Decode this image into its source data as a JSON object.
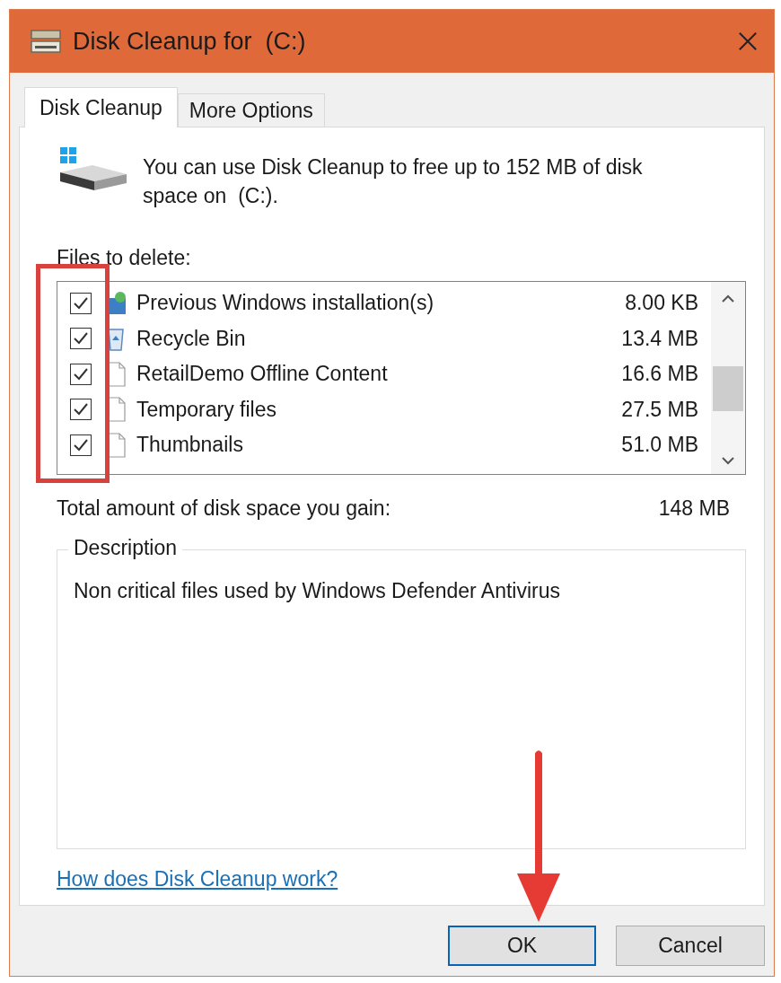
{
  "window": {
    "title": "Disk Cleanup for  (C:)"
  },
  "tabs": [
    {
      "label": "Disk Cleanup",
      "selected": true
    },
    {
      "label": "More Options",
      "selected": false
    }
  ],
  "intro": "You can use Disk Cleanup to free up to 152 MB of disk space on  (C:).",
  "files_label": "Files to delete:",
  "files": [
    {
      "name": "Previous Windows installation(s)",
      "size": "8.00 KB",
      "checked": true,
      "kind": "setup"
    },
    {
      "name": "Recycle Bin",
      "size": "13.4 MB",
      "checked": true,
      "kind": "recycle"
    },
    {
      "name": "RetailDemo Offline Content",
      "size": "16.6 MB",
      "checked": true,
      "kind": "file"
    },
    {
      "name": "Temporary files",
      "size": "27.5 MB",
      "checked": true,
      "kind": "file"
    },
    {
      "name": "Thumbnails",
      "size": "51.0 MB",
      "checked": true,
      "kind": "file"
    }
  ],
  "total": {
    "label": "Total amount of disk space you gain:",
    "value": "148 MB"
  },
  "description": {
    "title": "Description",
    "text": "Non critical files used by Windows Defender Antivirus"
  },
  "help_link": "How does Disk Cleanup work?",
  "buttons": [
    {
      "label": "OK",
      "default": true
    },
    {
      "label": "Cancel",
      "default": false
    }
  ]
}
